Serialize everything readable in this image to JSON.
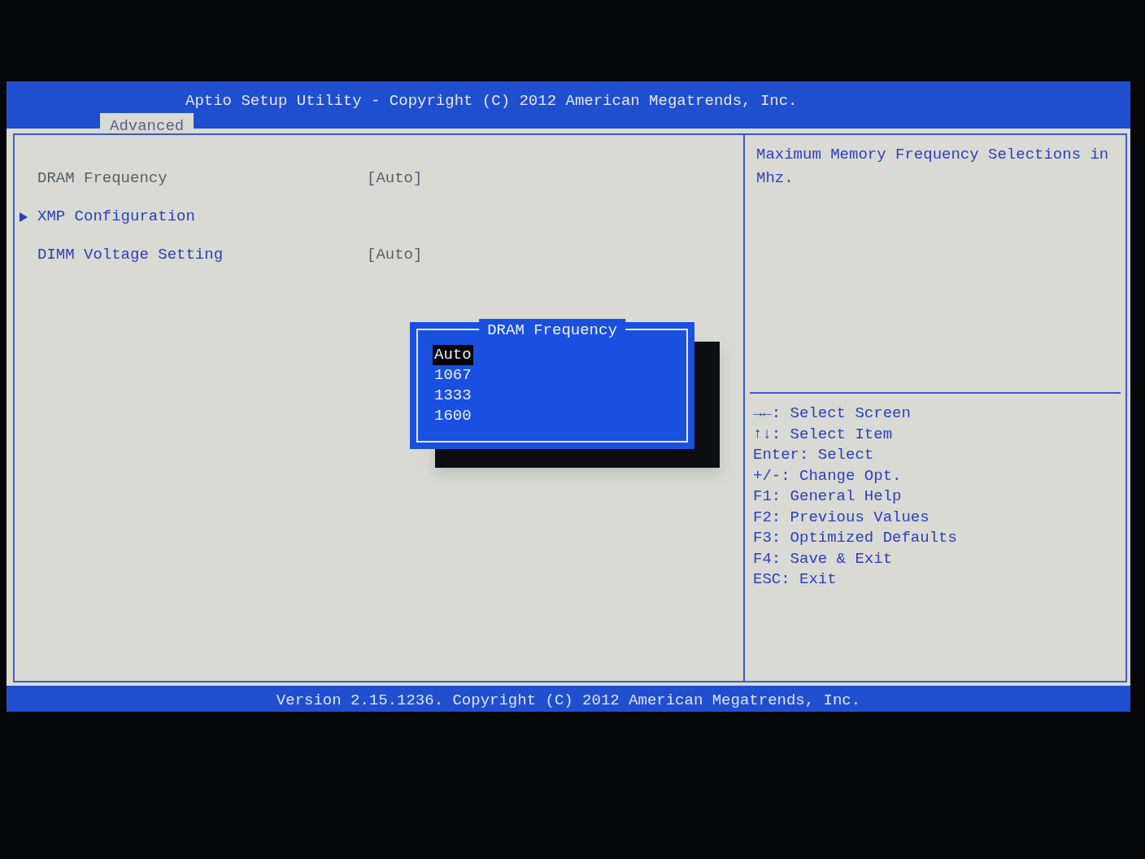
{
  "header": {
    "title": "Aptio Setup Utility - Copyright (C) 2012 American Megatrends, Inc.",
    "tabs": [
      {
        "label": "Advanced",
        "selected": true
      }
    ]
  },
  "settings": [
    {
      "kind": "option",
      "label": "DRAM Frequency",
      "value": "[Auto]",
      "selected": true
    },
    {
      "kind": "submenu",
      "label": "XMP Configuration",
      "selected": false
    },
    {
      "kind": "option",
      "label": "DIMM Voltage Setting",
      "value": "[Auto]",
      "selected": false
    }
  ],
  "help_text": "Maximum Memory Frequency Selections in Mhz.",
  "key_legend": [
    "→←: Select Screen",
    "↑↓: Select Item",
    "Enter: Select",
    "+/-: Change Opt.",
    "F1: General Help",
    "F2: Previous Values",
    "F3: Optimized Defaults",
    "F4: Save & Exit",
    "ESC: Exit"
  ],
  "popup": {
    "title": "DRAM Frequency",
    "options": [
      {
        "label": "Auto",
        "selected": true
      },
      {
        "label": "1067",
        "selected": false
      },
      {
        "label": "1333",
        "selected": false
      },
      {
        "label": "1600",
        "selected": false
      }
    ]
  },
  "footer": "Version 2.15.1236. Copyright (C) 2012 American Megatrends, Inc."
}
